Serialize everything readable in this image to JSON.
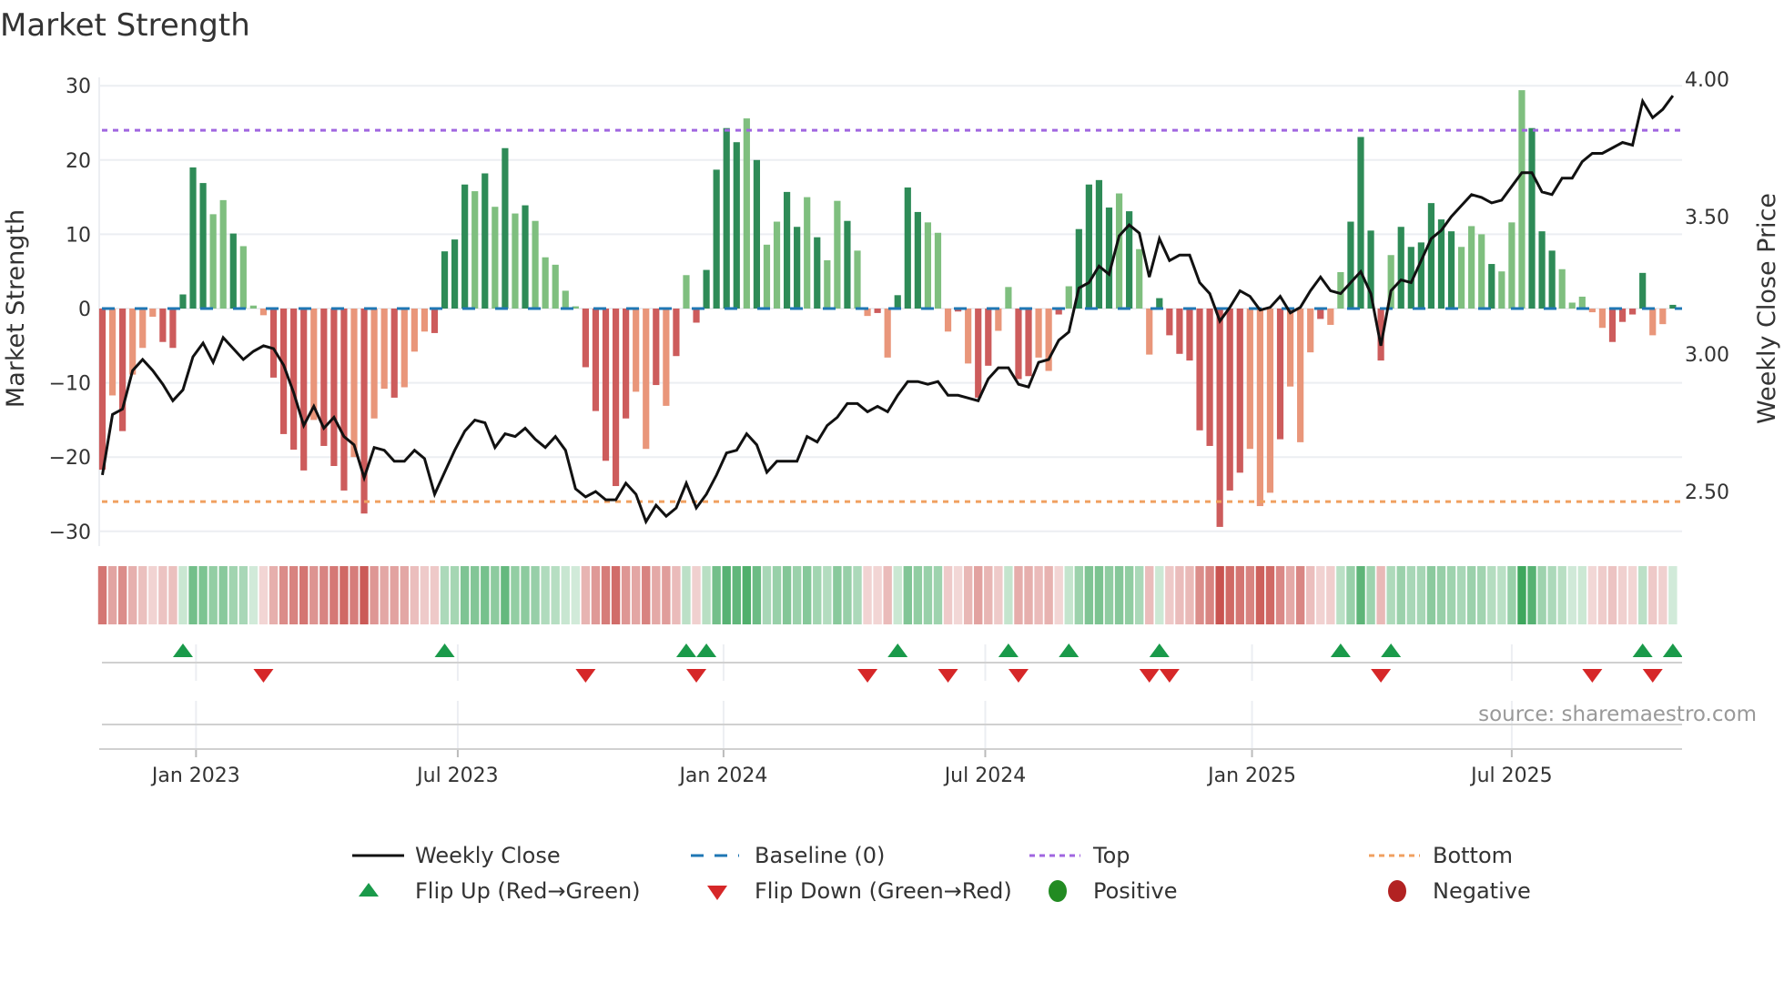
{
  "title": "Market Strength",
  "source": "source: sharemaestro.com",
  "colors": {
    "strong_pos": "#2e8b57",
    "weak_pos": "#7fbf7f",
    "strong_neg": "#cd5c5c",
    "weak_neg": "#e9967a",
    "close": "#111111",
    "baseline": "#1f77b4",
    "top": "#a066e0",
    "bottom": "#f0a060",
    "flip_up": "#1a9a4a",
    "flip_down": "#d62728",
    "positive": "#228b22",
    "negative": "#b22222"
  },
  "legend": {
    "weekly_close": "Weekly Close",
    "baseline": "Baseline (0)",
    "top": "Top",
    "bottom": "Bottom",
    "flip_up": "Flip Up (Red→Green)",
    "flip_down": "Flip Down (Green→Red)",
    "positive": "Positive",
    "negative": "Negative"
  },
  "chart_data": {
    "type": "bar",
    "title": "Market Strength",
    "ylabel": "Market Strength",
    "y2label": "Weekly Close Price",
    "ylim": [
      -32,
      32
    ],
    "y2lim": [
      2.33,
      4.05
    ],
    "yticks": [
      "30",
      "20",
      "10",
      "0",
      "−10",
      "−20",
      "−30"
    ],
    "ytick_values": [
      30,
      20,
      10,
      0,
      -10,
      -20,
      -30
    ],
    "y2ticks": [
      "4.00",
      "3.50",
      "3.00",
      "2.50"
    ],
    "y2tick_values": [
      4.0,
      3.5,
      3.0,
      2.5
    ],
    "xticks": [
      "Jan 2023",
      "Jul 2023",
      "Jan 2024",
      "Jul 2024",
      "Jan 2025",
      "Jul 2025"
    ],
    "xtick_week_index": [
      9.3,
      35.3,
      61.7,
      87.7,
      114.2,
      140.0
    ],
    "top_level": 24,
    "bottom_level": -26,
    "baseline": 0,
    "grid": true,
    "legend_position": "bottom",
    "strength": [
      -21.7,
      -11.7,
      -16.5,
      -8.9,
      -5.3,
      -1.1,
      -4.5,
      -5.3,
      1.9,
      19,
      16.9,
      12.7,
      14.6,
      10.1,
      8.4,
      0.4,
      -0.9,
      -9.3,
      -16.9,
      -19,
      -21.8,
      -15,
      -18.5,
      -21.2,
      -24.5,
      -20,
      -27.6,
      -14.8,
      -10.8,
      -12,
      -10.6,
      -5.8,
      -3.1,
      -3.3,
      7.7,
      9.3,
      16.7,
      15.8,
      18.2,
      13.7,
      21.6,
      12.8,
      13.9,
      11.8,
      6.9,
      5.9,
      2.4,
      0.3,
      -7.9,
      -13.8,
      -20.5,
      -23.9,
      -14.8,
      -11.2,
      -18.9,
      -10.3,
      -13.1,
      -6.4,
      4.5,
      -1.9,
      5.2,
      18.7,
      24.3,
      22.4,
      25.6,
      20,
      8.6,
      11.7,
      15.7,
      11,
      15,
      9.6,
      6.5,
      14.5,
      11.8,
      7.8,
      -1,
      -0.6,
      -6.6,
      1.8,
      16.3,
      13,
      11.6,
      10.2,
      -3.1,
      -0.4,
      -7.4,
      -12,
      -7.7,
      -3,
      2.9,
      -9.5,
      -9.1,
      -6.6,
      -8.4,
      -0.8,
      3,
      10.7,
      16.7,
      17.3,
      13.6,
      15.5,
      13.1,
      8,
      -6.2,
      1.4,
      -3.6,
      -6.1,
      -7,
      -16.4,
      -18.5,
      -29.4,
      -24.5,
      -22.1,
      -18.9,
      -26.6,
      -24.8,
      -17.6,
      -10.5,
      -18,
      -5.9,
      -1.4,
      -2.2,
      4.9,
      11.7,
      23.1,
      10.5,
      -7,
      7.2,
      11,
      8.3,
      8.9,
      14.2,
      12,
      10.4,
      8.3,
      11.1,
      10,
      6,
      5,
      11.6,
      29.4,
      24.3,
      10.4,
      7.8,
      5.3,
      0.8,
      1.6,
      -0.5,
      -2.6,
      -4.5,
      -1.8,
      -0.8,
      4.8,
      -3.6,
      -2.1,
      0.5
    ],
    "strength_shade": "dldllldddddlldlllddddldddldlldlllddddldldldllllldddddlldldldddddldllddldlldlldldddllldlddllddlldlddddldlldddddddddllldllldllddddlddddddllldllldddlllllddddllddll",
    "weekly_close": [
      2.56,
      2.78,
      2.8,
      2.94,
      2.98,
      2.94,
      2.89,
      2.83,
      2.87,
      2.99,
      3.04,
      2.97,
      3.06,
      3.02,
      2.98,
      3.01,
      3.03,
      3.02,
      2.96,
      2.86,
      2.74,
      2.81,
      2.73,
      2.77,
      2.7,
      2.67,
      2.55,
      2.66,
      2.65,
      2.61,
      2.61,
      2.65,
      2.62,
      2.49,
      2.57,
      2.65,
      2.72,
      2.76,
      2.75,
      2.66,
      2.71,
      2.7,
      2.73,
      2.69,
      2.66,
      2.7,
      2.65,
      2.51,
      2.48,
      2.5,
      2.47,
      2.47,
      2.53,
      2.49,
      2.39,
      2.45,
      2.41,
      2.44,
      2.53,
      2.44,
      2.49,
      2.56,
      2.64,
      2.65,
      2.71,
      2.67,
      2.57,
      2.61,
      2.61,
      2.61,
      2.7,
      2.68,
      2.74,
      2.77,
      2.82,
      2.82,
      2.79,
      2.81,
      2.79,
      2.85,
      2.9,
      2.9,
      2.89,
      2.9,
      2.85,
      2.85,
      2.84,
      2.83,
      2.91,
      2.95,
      2.95,
      2.89,
      2.88,
      2.97,
      2.98,
      3.05,
      3.08,
      3.24,
      3.26,
      3.32,
      3.29,
      3.43,
      3.47,
      3.44,
      3.28,
      3.42,
      3.34,
      3.36,
      3.36,
      3.26,
      3.22,
      3.12,
      3.17,
      3.23,
      3.21,
      3.16,
      3.17,
      3.21,
      3.15,
      3.17,
      3.23,
      3.28,
      3.23,
      3.22,
      3.26,
      3.3,
      3.22,
      3.03,
      3.23,
      3.27,
      3.26,
      3.34,
      3.42,
      3.45,
      3.5,
      3.54,
      3.58,
      3.57,
      3.55,
      3.56,
      3.61,
      3.66,
      3.66,
      3.59,
      3.58,
      3.64,
      3.64,
      3.7,
      3.73,
      3.73,
      3.75,
      3.77,
      3.76,
      3.92,
      3.86,
      3.89,
      3.94
    ]
  }
}
